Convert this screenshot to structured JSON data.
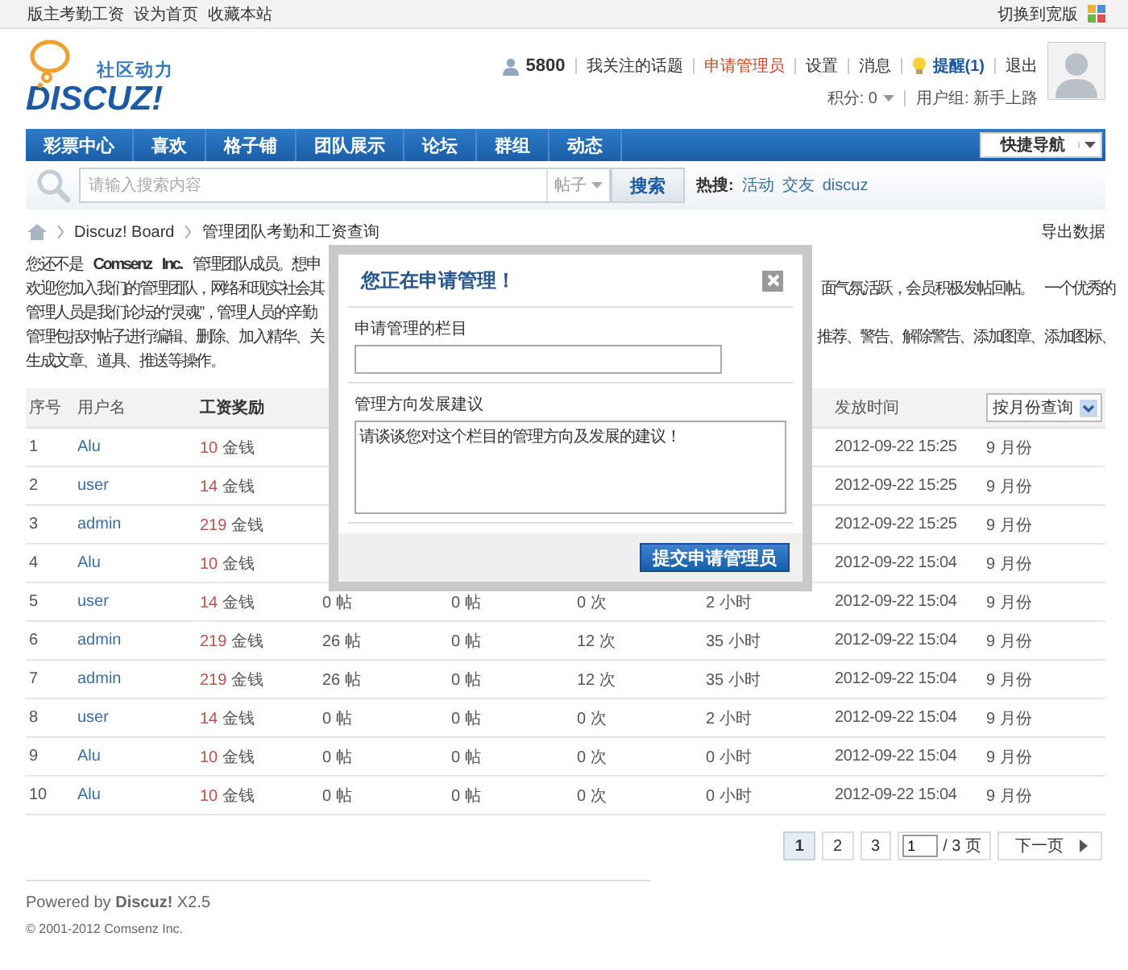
{
  "top_bar": {
    "links": [
      "版主考勤工资",
      "设为首页",
      "收藏本站"
    ],
    "wide_switch": "切换到宽版"
  },
  "logo": {
    "tagline": "社区动力",
    "wordmark": "DISCUZ!"
  },
  "user_panel": {
    "points": "5800",
    "links": [
      {
        "label": "我关注的话题",
        "kind": "link"
      },
      {
        "label": "申请管理员",
        "kind": "highlight"
      },
      {
        "label": "设置",
        "kind": "link"
      },
      {
        "label": "消息",
        "kind": "link"
      },
      {
        "label": "提醒(1)",
        "kind": "notice"
      },
      {
        "label": "退出",
        "kind": "link"
      }
    ],
    "credits": "积分: 0",
    "group": "用户组: 新手上路"
  },
  "nav": {
    "items": [
      {
        "label": "彩票中心",
        "selected": false
      },
      {
        "label": "喜欢",
        "selected": false
      },
      {
        "label": "格子铺",
        "selected": false
      },
      {
        "label": "团队展示",
        "selected": false
      },
      {
        "label": "论坛",
        "selected": false
      },
      {
        "label": "群组",
        "selected": false
      },
      {
        "label": "动态",
        "selected": false
      }
    ],
    "quick_nav": "快捷导航"
  },
  "search": {
    "placeholder": "请输入搜索内容",
    "scope": "帖子",
    "button": "搜索",
    "hot_label": "热搜:",
    "hot": [
      "活动",
      "交友",
      "discuz"
    ]
  },
  "breadcrumb": {
    "items": [
      "Discuz! Board",
      "管理团队考勤和工资查询"
    ],
    "export": "导出数据"
  },
  "intro": [
    {
      "left": "您还不是 **Comsenz Inc.** 管理团队成员。想申"
    },
    {
      "left": "欢迎您加入我们的管理团队，网络和现实社会其",
      "right": "面气氛活跃，会员积极发帖回帖。 一个优秀的"
    },
    {
      "left": "管理人员是我们论坛的“灵魂”，管理人员的辛勤"
    },
    {
      "left": "管理包括对帖子进行编辑、删除、加入精华、关",
      "right": "推荐、警告、解除警告、添加图章、添加图标、"
    },
    {
      "left": "生成文章、道具、推送等操作。"
    }
  ],
  "table": {
    "columns": [
      "序号",
      "用户名",
      "工资奖励"
    ],
    "time_column": "发放时间",
    "month_filter": "按月份查询",
    "rows": [
      {
        "no": "1",
        "user": "Alu",
        "reward": "10",
        "reward_unit": "金钱",
        "time": "2012-09-22 15:25",
        "month": "9 月份"
      },
      {
        "no": "2",
        "user": "user",
        "reward": "14",
        "reward_unit": "金钱",
        "time": "2012-09-22 15:25",
        "month": "9 月份"
      },
      {
        "no": "3",
        "user": "admin",
        "reward": "219",
        "reward_unit": "金钱",
        "time": "2012-09-22 15:25",
        "month": "9 月份"
      },
      {
        "no": "4",
        "user": "Alu",
        "reward": "10",
        "reward_unit": "金钱",
        "time": "2012-09-22 15:04",
        "month": "9 月份"
      },
      {
        "no": "5",
        "user": "user",
        "reward": "14",
        "reward_unit": "金钱",
        "posts": "0 帖",
        "col_5": "0 帖",
        "col_6": "0 次",
        "col_7": "2 小时",
        "time": "2012-09-22 15:04",
        "month": "9 月份"
      },
      {
        "no": "6",
        "user": "admin",
        "reward": "219",
        "reward_unit": "金钱",
        "posts": "26 帖",
        "col_5": "0 帖",
        "col_6": "12 次",
        "col_7": "35 小时",
        "time": "2012-09-22 15:04",
        "month": "9 月份"
      },
      {
        "no": "7",
        "user": "admin",
        "reward": "219",
        "reward_unit": "金钱",
        "posts": "26 帖",
        "col_5": "0 帖",
        "col_6": "12 次",
        "col_7": "35 小时",
        "time": "2012-09-22 15:04",
        "month": "9 月份"
      },
      {
        "no": "8",
        "user": "user",
        "reward": "14",
        "reward_unit": "金钱",
        "posts": "0 帖",
        "col_5": "0 帖",
        "col_6": "0 次",
        "col_7": "2 小时",
        "time": "2012-09-22 15:04",
        "month": "9 月份"
      },
      {
        "no": "9",
        "user": "Alu",
        "reward": "10",
        "reward_unit": "金钱",
        "posts": "0 帖",
        "col_5": "0 帖",
        "col_6": "0 次",
        "col_7": "0 小时",
        "time": "2012-09-22 15:04",
        "month": "9 月份"
      },
      {
        "no": "10",
        "user": "Alu",
        "reward": "10",
        "reward_unit": "金钱",
        "posts": "0 帖",
        "col_5": "0 帖",
        "col_6": "0 次",
        "col_7": "0 小时",
        "time": "2012-09-22 15:04",
        "month": "9 月份"
      }
    ]
  },
  "dialog": {
    "title": "您正在申请管理！",
    "field_label": "申请管理的栏目",
    "suggest_label": "管理方向发展建议",
    "suggest_value": "请谈谈您对这个栏目的管理方向及发展的建议！",
    "submit": "提交申请管理员"
  },
  "pagination": {
    "pages": [
      {
        "label": "1",
        "selected": true
      },
      {
        "label": "2",
        "selected": false
      },
      {
        "label": "3",
        "selected": false
      }
    ],
    "page_input": "1",
    "total": "/ 3 页",
    "next": "下一页"
  },
  "footer": {
    "powered": "Powered by **Discuz!** X2.5",
    "copyright": "© 2001-2012 Comsenz Inc."
  }
}
